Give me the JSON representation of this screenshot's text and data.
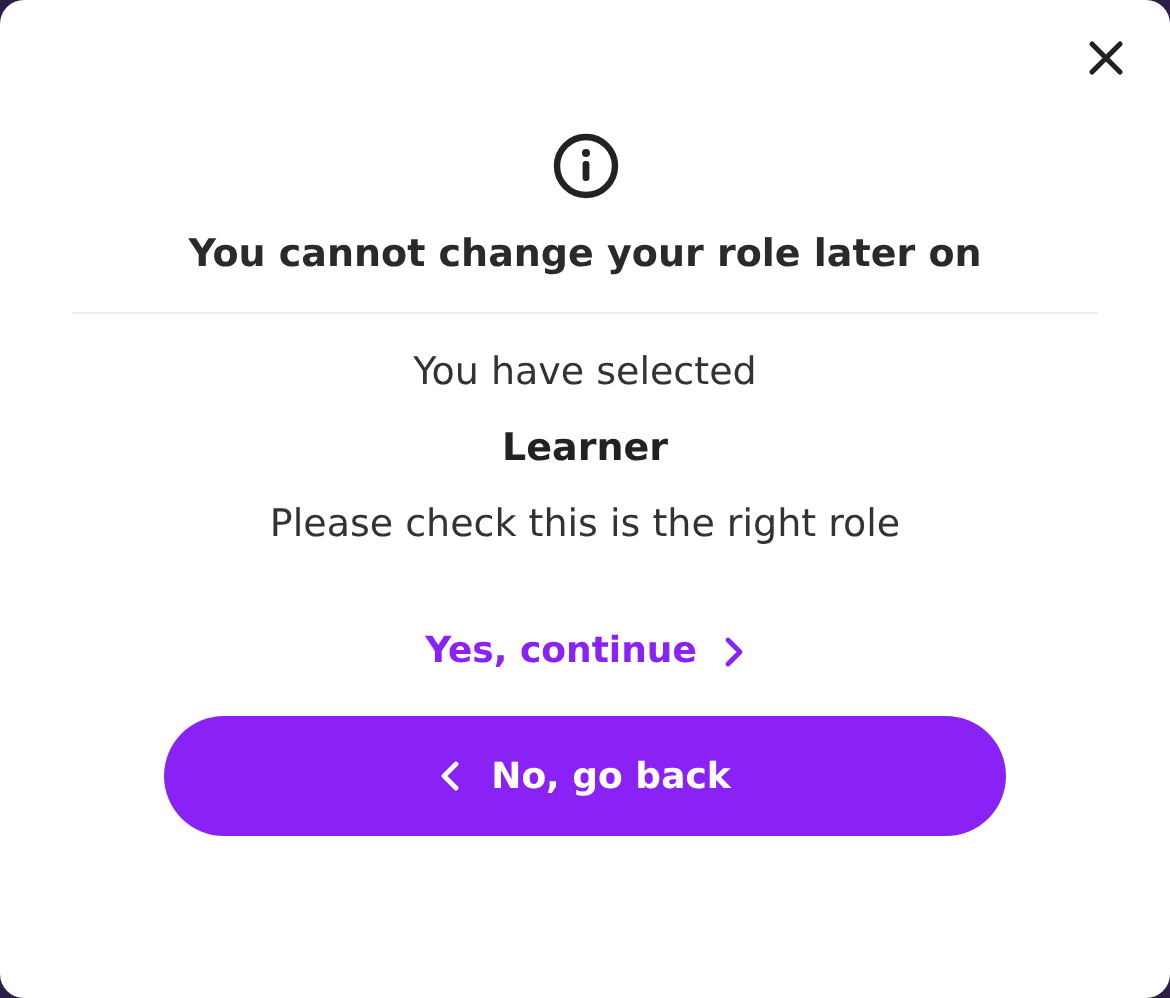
{
  "dialog": {
    "title": "You cannot change your role later on",
    "lines": [
      {
        "text": "You have selected",
        "kind": "plain"
      },
      {
        "text": "Learner",
        "kind": "emphasis"
      },
      {
        "text": "Please check this is the right role",
        "kind": "plain"
      }
    ],
    "confirm_link": {
      "label": "Yes, continue"
    },
    "back_button": {
      "label": "No, go back"
    }
  }
}
